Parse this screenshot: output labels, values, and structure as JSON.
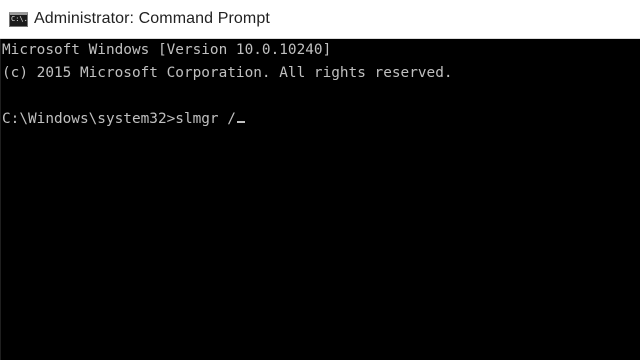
{
  "window": {
    "title": "Administrator: Command Prompt",
    "icon": "cmd-icon",
    "icon_text": "C:\\."
  },
  "console": {
    "lines": [
      "Microsoft Windows [Version 10.0.10240]",
      "(c) 2015 Microsoft Corporation. All rights reserved.",
      "",
      "C:\\Windows\\system32>slmgr /"
    ],
    "colors": {
      "background": "#000000",
      "text": "#c0c0c0"
    }
  }
}
